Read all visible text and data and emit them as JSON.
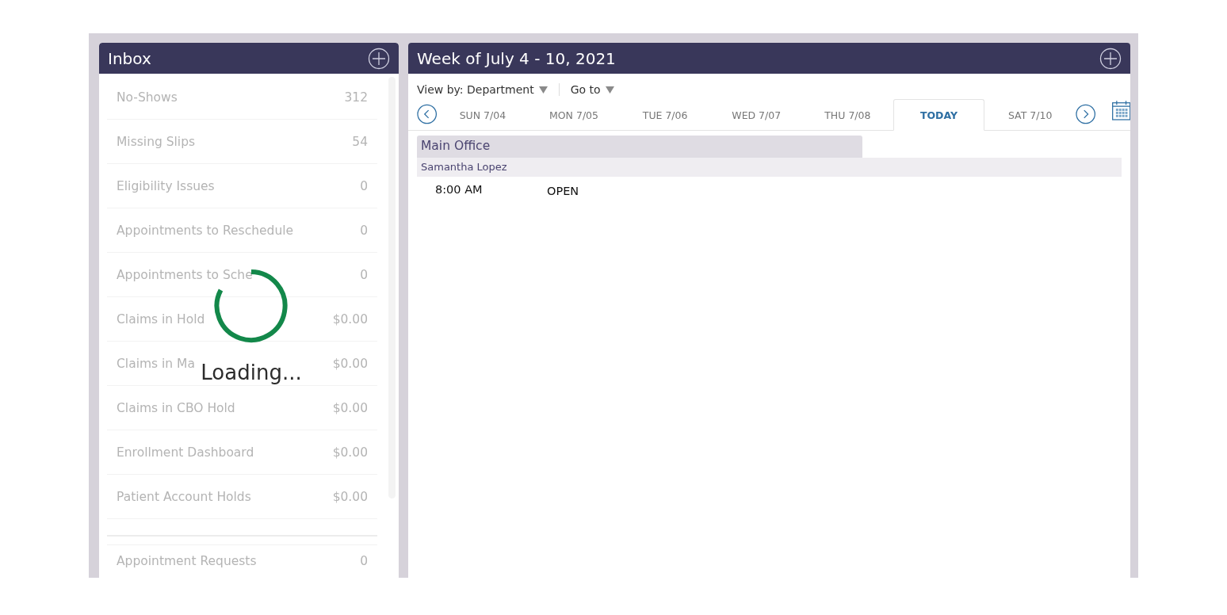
{
  "inbox": {
    "title": "Inbox",
    "items": [
      {
        "label": "No-Shows",
        "count": "312"
      },
      {
        "label": "Missing Slips",
        "count": "54"
      },
      {
        "label": "Eligibility Issues",
        "count": "0"
      },
      {
        "label": "Appointments to Reschedule",
        "count": "0"
      },
      {
        "label": "Appointments to Sche",
        "count": "0"
      },
      {
        "label": "Claims in Hold",
        "count": "$0.00"
      },
      {
        "label": "Claims in Ma",
        "count": "$0.00"
      },
      {
        "label": "Claims in CBO Hold",
        "count": "$0.00"
      },
      {
        "label": "Enrollment Dashboard",
        "count": "$0.00"
      },
      {
        "label": "Patient Account Holds",
        "count": "$0.00"
      }
    ],
    "extra_items": [
      {
        "label": "Appointment Requests",
        "count": "0"
      }
    ],
    "loading": "Loading..."
  },
  "schedule": {
    "title": "Week of July 4 - 10, 2021",
    "view_by": "View by: Department",
    "go_to": "Go to",
    "days": [
      {
        "label": "SUN 7/04",
        "selected": false
      },
      {
        "label": "MON 7/05",
        "selected": false
      },
      {
        "label": "TUE 7/06",
        "selected": false
      },
      {
        "label": "WED 7/07",
        "selected": false
      },
      {
        "label": "THU 7/08",
        "selected": false
      },
      {
        "label": "TODAY",
        "selected": true
      },
      {
        "label": "SAT 7/10",
        "selected": false
      }
    ],
    "department": "Main Office",
    "provider": "Samantha Lopez",
    "slots": [
      {
        "time": "8:00 AM",
        "status": "OPEN"
      }
    ]
  }
}
